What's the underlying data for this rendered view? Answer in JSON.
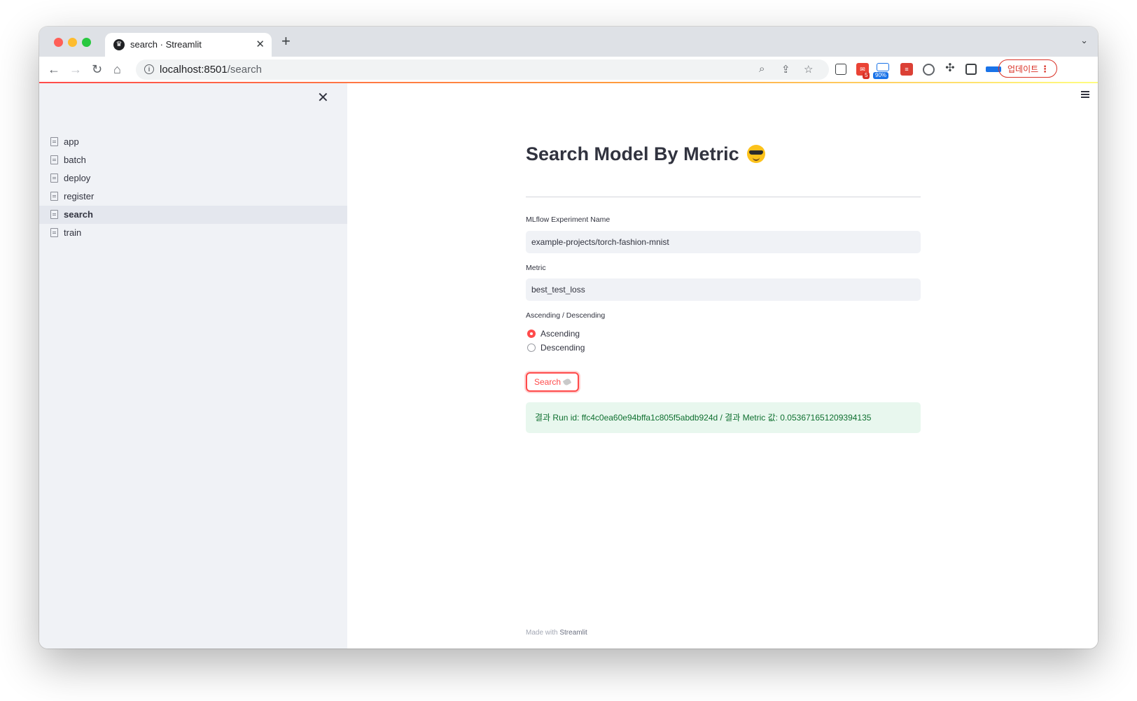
{
  "browser": {
    "tab_title": "search · Streamlit",
    "tab_favicon_icon": "streamlit-crown-icon",
    "new_tab_label": "+",
    "url_host": "localhost:8501",
    "url_path": "/search",
    "update_button_label": "업데이트",
    "ext_mail_badge": "5",
    "ext_cloud_badge": "90%"
  },
  "sidebar": {
    "close_icon": "close-icon",
    "items": [
      {
        "label": "app",
        "active": false
      },
      {
        "label": "batch",
        "active": false
      },
      {
        "label": "deploy",
        "active": false
      },
      {
        "label": "register",
        "active": false
      },
      {
        "label": "search",
        "active": true
      },
      {
        "label": "train",
        "active": false
      }
    ]
  },
  "main": {
    "title": "Search Model By Metric",
    "title_emoji_icon": "sunglasses-face-icon",
    "experiment": {
      "label": "MLflow Experiment Name",
      "value": "example-projects/torch-fashion-mnist"
    },
    "metric": {
      "label": "Metric",
      "value": "best_test_loss"
    },
    "order": {
      "label": "Ascending / Descending",
      "options": [
        "Ascending",
        "Descending"
      ],
      "selected": "Ascending"
    },
    "search_button_label": "Search",
    "search_button_icon": "broom-icon",
    "result": "결과 Run id: ffc4c0ea60e94bffa1c805f5abdb924d / 결과 Metric 값: 0.053671651209394135"
  },
  "footer": {
    "prefix": "Made with",
    "brand": "Streamlit"
  },
  "colors": {
    "accent": "#ff4b4b",
    "sidebar_bg": "#f0f2f6",
    "success_bg": "#e8f7ee",
    "success_text": "#0f7030"
  }
}
